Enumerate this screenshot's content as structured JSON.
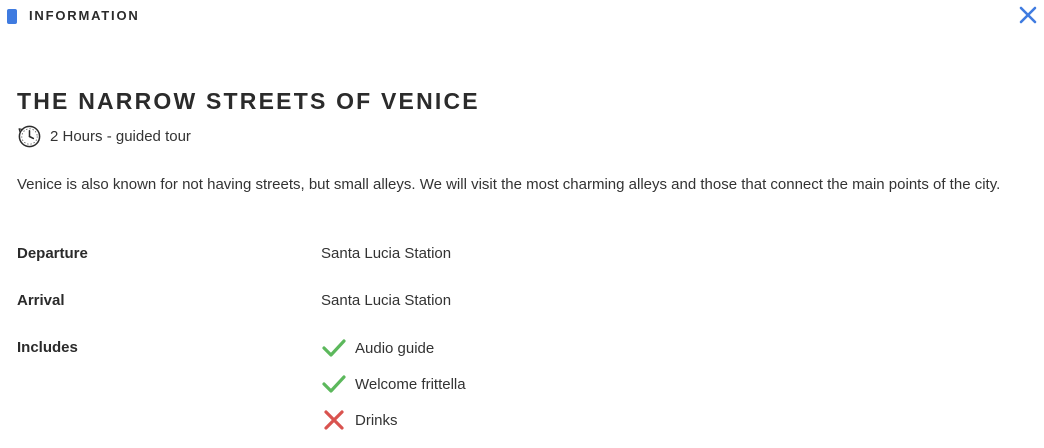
{
  "header": {
    "title": "INFORMATION",
    "accent_color": "#3f7be0",
    "close_icon": "close-icon"
  },
  "tour": {
    "title": "THE NARROW STREETS OF VENICE",
    "duration_icon": "clock-icon",
    "duration": "2 Hours - guided tour",
    "description": "Venice is also known for not having streets, but small alleys. We will visit the most charming alleys and those that connect the main points of the city."
  },
  "details": {
    "departure_label": "Departure",
    "departure_value": "Santa Lucia Station",
    "arrival_label": "Arrival",
    "arrival_value": "Santa Lucia Station",
    "includes_label": "Includes",
    "includes": [
      {
        "label": "Audio guide",
        "included": true,
        "icon": "check-icon"
      },
      {
        "label": "Welcome frittella",
        "included": true,
        "icon": "check-icon"
      },
      {
        "label": "Drinks",
        "included": false,
        "icon": "cross-icon"
      }
    ]
  },
  "colors": {
    "included": "#5cb85c",
    "not_included": "#d9534f"
  }
}
